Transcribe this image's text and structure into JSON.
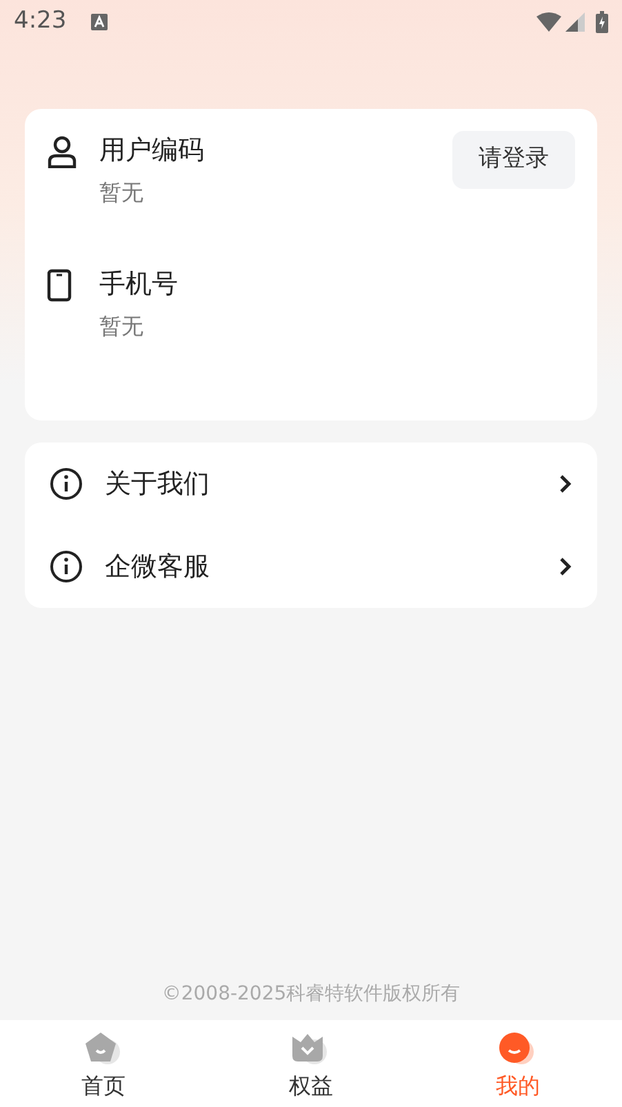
{
  "status_bar": {
    "time": "4:23"
  },
  "profile": {
    "fields": [
      {
        "kind": "user",
        "label": "用户编码",
        "value": "暂无",
        "action": "请登录"
      },
      {
        "kind": "phone",
        "label": "手机号",
        "value": "暂无"
      }
    ]
  },
  "menu": [
    {
      "label": "关于我们"
    },
    {
      "label": "企微客服"
    }
  ],
  "footer": "©2008-2025科睿特软件版权所有",
  "tabs": [
    {
      "kind": "home",
      "label": "首页",
      "selected": false
    },
    {
      "kind": "benefits",
      "label": "权益",
      "selected": false
    },
    {
      "kind": "mine",
      "label": "我的",
      "selected": true
    }
  ]
}
